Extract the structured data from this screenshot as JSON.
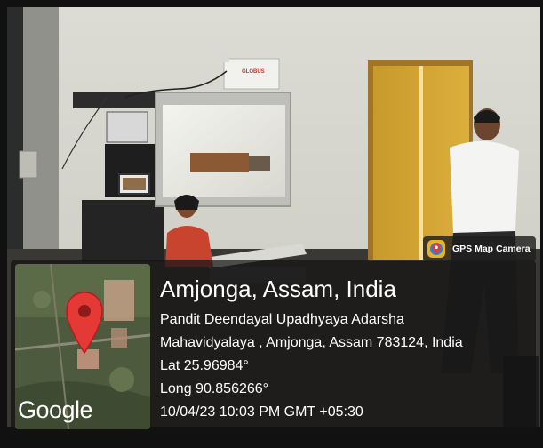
{
  "camera_badge": {
    "label": "GPS Map Camera",
    "icon": "gps-map-camera-icon"
  },
  "location": {
    "title": "Amjonga, Assam, India",
    "address_line1": "Pandit Deendayal Upadhyaya Adarsha",
    "address_line2": "Mahavidyalaya , Amjonga, Assam 783124, India",
    "lat": "Lat 25.96984°",
    "long": "Long 90.856266°",
    "timestamp": "10/04/23 10:03 PM GMT +05:30"
  },
  "map": {
    "brand": "Google",
    "pin_color": "#e53935"
  },
  "projector": {
    "brand_text": "GLOBUS"
  }
}
